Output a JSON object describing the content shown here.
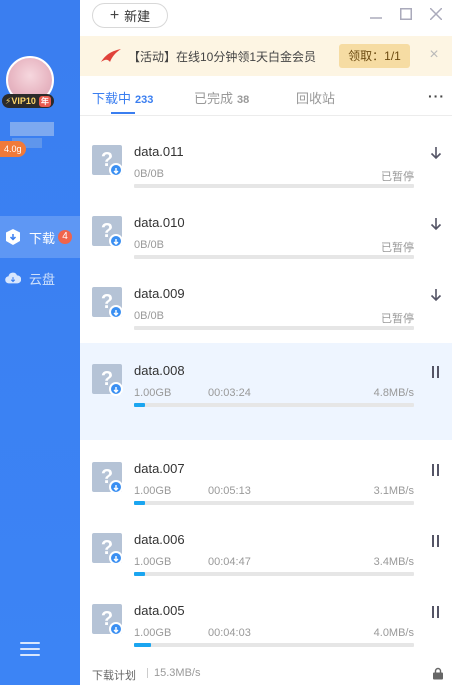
{
  "sidebar": {
    "vip_label": "VIP10",
    "vip_year": "年",
    "speed_tag": "4.0g",
    "nav": [
      {
        "label": "下载",
        "count": "4"
      },
      {
        "label": "云盘"
      }
    ]
  },
  "topbar": {
    "new_label": "新建"
  },
  "banner": {
    "text": "【活动】在线10分钟领1天白金会员",
    "claim": "领取：1/1"
  },
  "tabs": [
    {
      "label": "下载中",
      "count": "233"
    },
    {
      "label": "已完成",
      "count": "38"
    },
    {
      "label": "回收站",
      "count": ""
    }
  ],
  "downloads": [
    {
      "name": "data.011",
      "size": "0B/0B",
      "time": "",
      "right": "已暂停",
      "progress": 0,
      "action": "resume"
    },
    {
      "name": "data.010",
      "size": "0B/0B",
      "time": "",
      "right": "已暂停",
      "progress": 0,
      "action": "resume"
    },
    {
      "name": "data.009",
      "size": "0B/0B",
      "time": "",
      "right": "已暂停",
      "progress": 0,
      "action": "resume"
    },
    {
      "name": "data.008",
      "size": "1.00GB",
      "time": "00:03:24",
      "right": "4.8MB/s",
      "progress": 0.04,
      "action": "pause"
    },
    {
      "name": "data.007",
      "size": "1.00GB",
      "time": "00:05:13",
      "right": "3.1MB/s",
      "progress": 0.04,
      "action": "pause"
    },
    {
      "name": "data.006",
      "size": "1.00GB",
      "time": "00:04:47",
      "right": "3.4MB/s",
      "progress": 0.04,
      "action": "pause"
    },
    {
      "name": "data.005",
      "size": "1.00GB",
      "time": "00:04:03",
      "right": "4.0MB/s",
      "progress": 0.06,
      "action": "pause"
    }
  ],
  "footer": {
    "label": "下载计划",
    "speed": "15.3MB/s"
  },
  "colors": {
    "accent": "#3a7ef0",
    "progress": "#1aa5f0",
    "badge": "#f0644c"
  }
}
